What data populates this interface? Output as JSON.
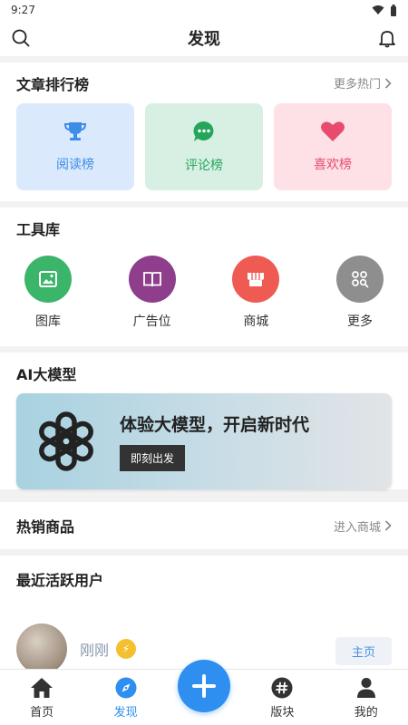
{
  "status": {
    "time": "9:27"
  },
  "header": {
    "title": "发现"
  },
  "ranking": {
    "title": "文章排行榜",
    "more": "更多热门",
    "cards": [
      {
        "label": "阅读榜",
        "bg": "#dbe9fc",
        "color": "#3d8ce8",
        "icon": "trophy-icon"
      },
      {
        "label": "评论榜",
        "bg": "#d8efe3",
        "color": "#24a65a",
        "icon": "comment-icon"
      },
      {
        "label": "喜欢榜",
        "bg": "#fde1e6",
        "color": "#e84b6b",
        "icon": "heart-icon"
      }
    ]
  },
  "tools": {
    "title": "工具库",
    "items": [
      {
        "label": "图库",
        "color": "#3bb56a",
        "icon": "image-icon"
      },
      {
        "label": "广告位",
        "color": "#8e3e8a",
        "icon": "book-icon"
      },
      {
        "label": "商城",
        "color": "#ef5a52",
        "icon": "shop-icon"
      },
      {
        "label": "更多",
        "color": "#8e8e8e",
        "icon": "more-grid-icon"
      }
    ]
  },
  "ai": {
    "title": "AI大模型",
    "headline": "体验大模型，开启新时代",
    "cta": "即刻出发"
  },
  "products": {
    "title": "热销商品",
    "more": "进入商城"
  },
  "active_users": {
    "title": "最近活跃用户",
    "users": [
      {
        "name": "刚刚",
        "button": "主页"
      }
    ]
  },
  "nav": {
    "items": [
      {
        "label": "首页"
      },
      {
        "label": "发现"
      },
      {
        "label": "版块"
      },
      {
        "label": "我的"
      }
    ],
    "active_color": "#2e8ff0"
  }
}
